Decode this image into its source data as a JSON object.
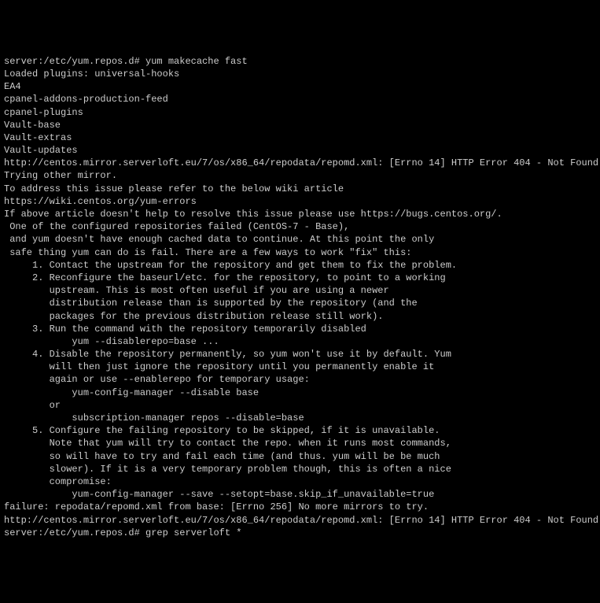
{
  "lines": {
    "l0": "server:/etc/yum.repos.d# yum makecache fast",
    "l1": "Loaded plugins: universal-hooks",
    "l2": "EA4",
    "l3": "cpanel-addons-production-feed",
    "l4": "cpanel-plugins",
    "l5": "Vault-base",
    "l6": "Vault-extras",
    "l7": "Vault-updates",
    "l8": "http://centos.mirror.serverloft.eu/7/os/x86_64/repodata/repomd.xml: [Errno 14] HTTP Error 404 - Not Found",
    "l9": "Trying other mirror.",
    "l10": "To address this issue please refer to the below wiki article",
    "l11": "",
    "l12": "https://wiki.centos.org/yum-errors",
    "l13": "",
    "l14": "If above article doesn't help to resolve this issue please use https://bugs.centos.org/.",
    "l15": "",
    "l16": "",
    "l17": "",
    "l18": " One of the configured repositories failed (CentOS-7 - Base),",
    "l19": " and yum doesn't have enough cached data to continue. At this point the only",
    "l20": " safe thing yum can do is fail. There are a few ways to work \"fix\" this:",
    "l21": "",
    "l22": "     1. Contact the upstream for the repository and get them to fix the problem.",
    "l23": "",
    "l24": "     2. Reconfigure the baseurl/etc. for the repository, to point to a working",
    "l25": "        upstream. This is most often useful if you are using a newer",
    "l26": "        distribution release than is supported by the repository (and the",
    "l27": "        packages for the previous distribution release still work).",
    "l28": "",
    "l29": "     3. Run the command with the repository temporarily disabled",
    "l30": "            yum --disablerepo=base ...",
    "l31": "",
    "l32": "     4. Disable the repository permanently, so yum won't use it by default. Yum",
    "l33": "        will then just ignore the repository until you permanently enable it",
    "l34": "        again or use --enablerepo for temporary usage:",
    "l35": "",
    "l36": "            yum-config-manager --disable base",
    "l37": "        or",
    "l38": "            subscription-manager repos --disable=base",
    "l39": "",
    "l40": "     5. Configure the failing repository to be skipped, if it is unavailable.",
    "l41": "        Note that yum will try to contact the repo. when it runs most commands,",
    "l42": "        so will have to try and fail each time (and thus. yum will be be much",
    "l43": "        slower). If it is a very temporary problem though, this is often a nice",
    "l44": "        compromise:",
    "l45": "",
    "l46": "            yum-config-manager --save --setopt=base.skip_if_unavailable=true",
    "l47": "",
    "l48": "failure: repodata/repomd.xml from base: [Errno 256] No more mirrors to try.",
    "l49": "http://centos.mirror.serverloft.eu/7/os/x86_64/repodata/repomd.xml: [Errno 14] HTTP Error 404 - Not Found",
    "l50": "server:/etc/yum.repos.d# grep serverloft *"
  }
}
